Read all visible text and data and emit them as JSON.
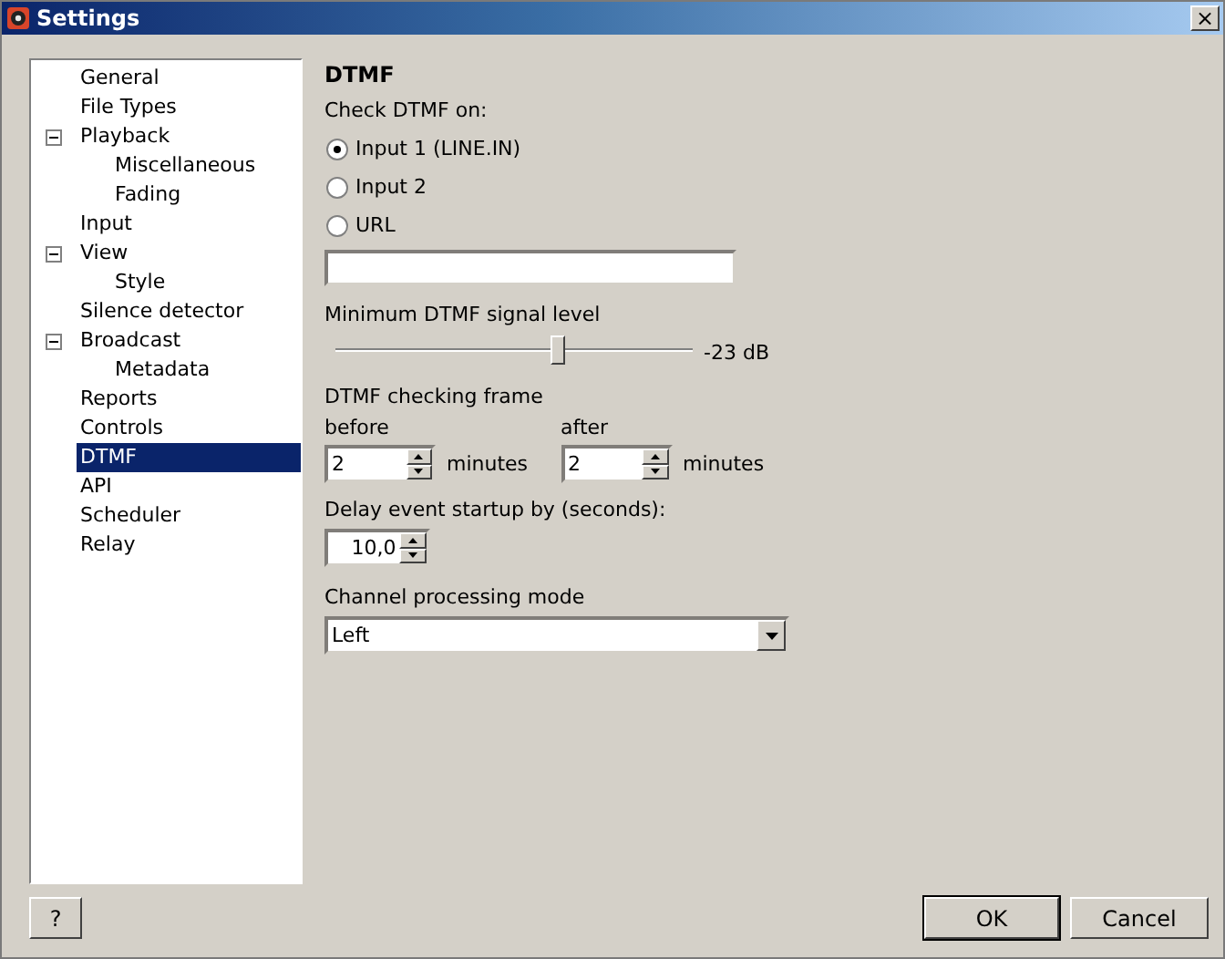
{
  "window": {
    "title": "Settings",
    "close": "×"
  },
  "tree": [
    {
      "label": "General",
      "selected": false
    },
    {
      "label": "File Types",
      "selected": false
    },
    {
      "label": "Playback",
      "selected": false,
      "expanded": true,
      "children": [
        {
          "label": "Miscellaneous",
          "selected": false
        },
        {
          "label": "Fading",
          "selected": false
        }
      ]
    },
    {
      "label": "Input",
      "selected": false
    },
    {
      "label": "View",
      "selected": false,
      "expanded": true,
      "children": [
        {
          "label": "Style",
          "selected": false
        }
      ]
    },
    {
      "label": "Silence detector",
      "selected": false
    },
    {
      "label": "Broadcast",
      "selected": false,
      "expanded": true,
      "children": [
        {
          "label": "Metadata",
          "selected": false
        }
      ]
    },
    {
      "label": "Reports",
      "selected": false
    },
    {
      "label": "Controls",
      "selected": false
    },
    {
      "label": "DTMF",
      "selected": true
    },
    {
      "label": "API",
      "selected": false
    },
    {
      "label": "Scheduler",
      "selected": false
    },
    {
      "label": "Relay",
      "selected": false
    }
  ],
  "panel": {
    "title": "DTMF",
    "check_label": "Check DTMF on:",
    "sources": [
      {
        "label": "Input 1 (LINE.IN)",
        "selected": true
      },
      {
        "label": "Input 2",
        "selected": false
      },
      {
        "label": "URL",
        "selected": false
      }
    ],
    "level_label": "Minimum DTMF signal level",
    "level": 0.62,
    "level_reading": "-23 dB",
    "frame_label": "DTMF checking frame",
    "frames": [
      {
        "label": "before",
        "value": "2",
        "unit": "minutes"
      },
      {
        "label": "after",
        "value": "2",
        "unit": "minutes"
      }
    ],
    "delay_label": "Delay event startup by (seconds):",
    "delay_value": "10,0",
    "channel_label": "Channel processing mode",
    "channel_value": "Left"
  },
  "buttons": {
    "help": "?",
    "ok": "OK",
    "cancel": "Cancel"
  }
}
